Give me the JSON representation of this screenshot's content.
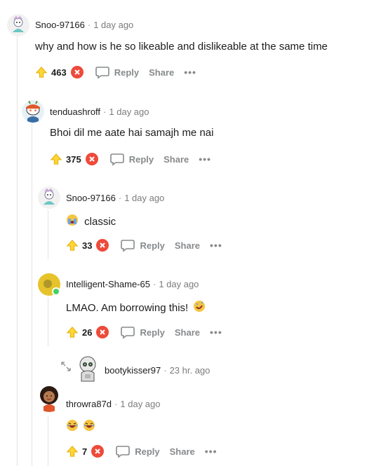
{
  "comments": [
    {
      "username": "Snoo-97166",
      "time": "1 day ago",
      "body": "why and how is he so likeable and dislikeable at the same time",
      "score": "463",
      "emoji": ""
    },
    {
      "username": "tenduashroff",
      "time": "1 day ago",
      "body": "Bhoi dil me aate hai samajh me nai",
      "score": "375",
      "emoji": ""
    },
    {
      "username": "Snoo-97166",
      "time": "1 day ago",
      "body": "classic",
      "score": "33",
      "emoji": "crying-face-emoji"
    },
    {
      "username": "Intelligent-Shame-65",
      "time": "1 day ago",
      "body": "LMAO. Am borrowing this!",
      "score": "26",
      "emoji": "rofl-emoji"
    },
    {
      "username": "bootykisser97",
      "time": "23 hr. ago"
    },
    {
      "username": "throwra87d",
      "time": "1 day ago",
      "body": "",
      "score": "7",
      "emoji": "laughing-emoji"
    }
  ],
  "labels": {
    "reply": "Reply",
    "share": "Share",
    "more": "•••",
    "sep": "·"
  },
  "colors": {
    "downvote": "#ee4a3a",
    "upvote": "#ffd635",
    "online": "#46d160"
  }
}
